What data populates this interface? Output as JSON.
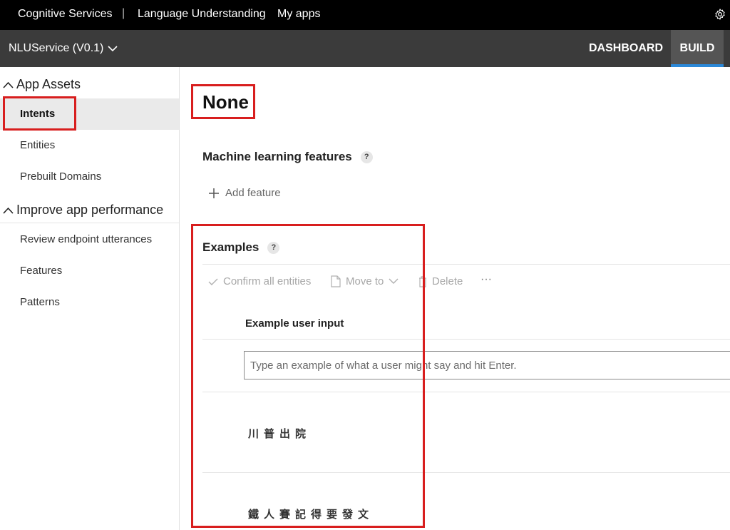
{
  "topbar": {
    "brand": "Cognitive Services",
    "separator": "|",
    "product": "Language Understanding",
    "my_apps": "My apps",
    "settings_icon": "gear-icon"
  },
  "appbar": {
    "app_name": "NLUService (V0.1)",
    "tabs": [
      {
        "label": "DASHBOARD",
        "active": false
      },
      {
        "label": "BUILD",
        "active": true
      }
    ]
  },
  "sidebar": {
    "groups": [
      {
        "label": "App Assets",
        "items": [
          {
            "label": "Intents",
            "active": true
          },
          {
            "label": "Entities"
          },
          {
            "label": "Prebuilt Domains"
          }
        ]
      },
      {
        "label": "Improve app performance",
        "items": [
          {
            "label": "Review endpoint utterances"
          },
          {
            "label": "Features"
          },
          {
            "label": "Patterns"
          }
        ]
      }
    ]
  },
  "main": {
    "title": "None",
    "ml_features": {
      "title": "Machine learning features",
      "help": "?",
      "add_label": "Add feature"
    },
    "examples": {
      "title": "Examples",
      "help": "?",
      "toolbar": {
        "confirm": "Confirm all entities",
        "move_to": "Move to",
        "delete": "Delete",
        "more": "···"
      },
      "column_header": "Example user input",
      "input_placeholder": "Type an example of what a user might say and hit Enter.",
      "utterances": [
        "川普出院",
        "鐵人賽記得要發文"
      ]
    }
  },
  "colors": {
    "topbar_bg": "#000000",
    "appbar_bg": "#3b3b3b",
    "active_tab_underline": "#2b88d8",
    "highlight_red": "#d81e1e"
  }
}
